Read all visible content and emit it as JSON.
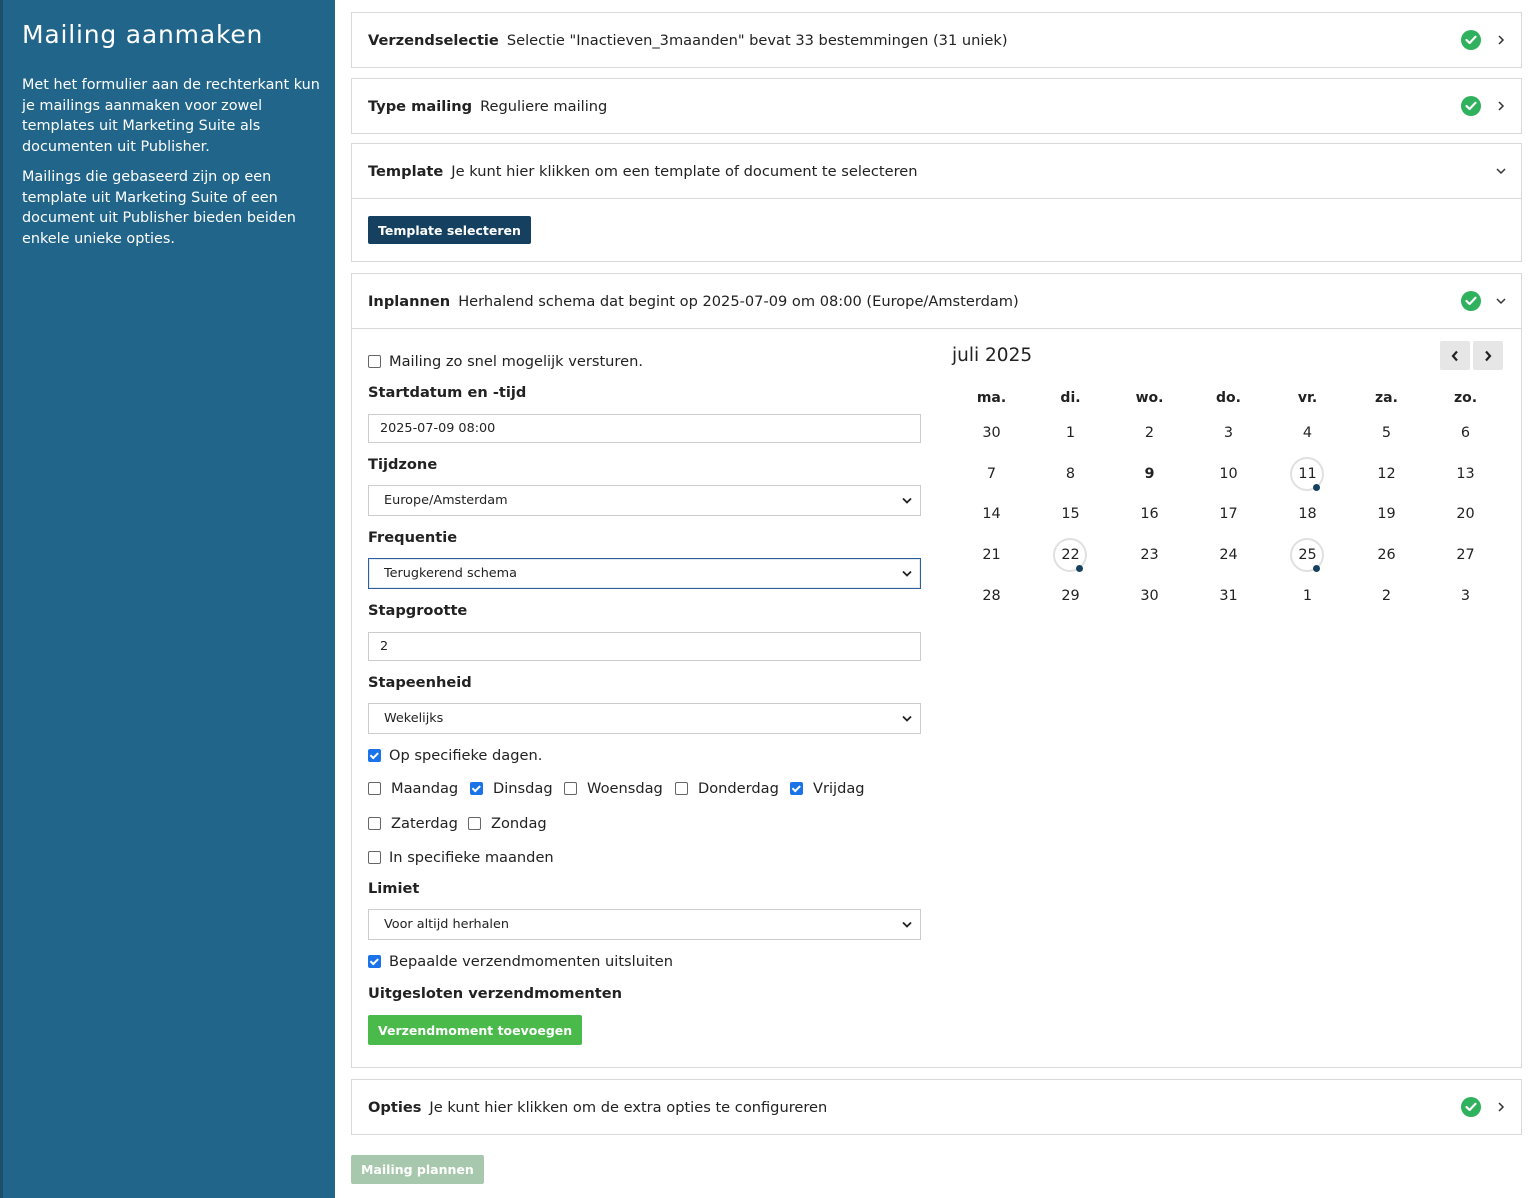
{
  "sidebar": {
    "title": "Mailing aanmaken",
    "paragraph1": "Met het formulier aan de rechterkant kun je mailings aanmaken voor zowel templates uit Marketing Suite als documenten uit Publisher.",
    "paragraph2": "Mailings die gebaseerd zijn op een template uit Marketing Suite of een document uit Publisher bieden beiden enkele unieke opties."
  },
  "panels": {
    "verzendselectie": {
      "title": "Verzendselectie",
      "summary": "Selectie \"Inactieven_3maanden\" bevat 33 bestemmingen (31 uniek)"
    },
    "type": {
      "title": "Type mailing",
      "summary": "Reguliere mailing"
    },
    "template": {
      "title": "Template",
      "summary": "Je kunt hier klikken om een template of document te selecteren",
      "button": "Template selecteren"
    },
    "inplannen": {
      "title": "Inplannen",
      "summary": "Herhalend schema dat begint op 2025-07-09 om 08:00 (Europe/Amsterdam)"
    },
    "opties": {
      "title": "Opties",
      "summary": "Je kunt hier klikken om de extra opties te configureren"
    }
  },
  "form": {
    "asap_label": "Mailing zo snel mogelijk versturen.",
    "start_label": "Startdatum en -tijd",
    "start_value": "2025-07-09 08:00",
    "timezone_label": "Tijdzone",
    "timezone_value": "Europe/Amsterdam",
    "frequency_label": "Frequentie",
    "frequency_value": "Terugkerend schema",
    "step_label": "Stapgrootte",
    "step_value": "2",
    "unit_label": "Stapeenheid",
    "unit_value": "Wekelijks",
    "specific_days_label": "Op specifieke dagen.",
    "days": [
      "Maandag",
      "Dinsdag",
      "Woensdag",
      "Donderdag",
      "Vrijdag",
      "Zaterdag",
      "Zondag"
    ],
    "specific_months_label": "In specifieke maanden",
    "limit_label": "Limiet",
    "limit_value": "Voor altijd herhalen",
    "exclude_label": "Bepaalde verzendmomenten uitsluiten",
    "excluded_title": "Uitgesloten verzendmomenten",
    "add_button": "Verzendmoment toevoegen"
  },
  "calendar": {
    "title": "juli 2025",
    "weekdays": [
      "ma.",
      "di.",
      "wo.",
      "do.",
      "vr.",
      "za.",
      "zo."
    ],
    "weeks": [
      [
        "30",
        "1",
        "2",
        "3",
        "4",
        "5",
        "6"
      ],
      [
        "7",
        "8",
        "9",
        "10",
        "11",
        "12",
        "13"
      ],
      [
        "14",
        "15",
        "16",
        "17",
        "18",
        "19",
        "20"
      ],
      [
        "21",
        "22",
        "23",
        "24",
        "25",
        "26",
        "27"
      ],
      [
        "28",
        "29",
        "30",
        "31",
        "1",
        "2",
        "3"
      ]
    ],
    "today": "9",
    "scheduled": [
      "11",
      "22",
      "25"
    ]
  },
  "footer": {
    "submit_button": "Mailing plannen"
  },
  "colors": {
    "sidebar": "#21658a",
    "accent_dark": "#16405f",
    "success": "#2fb15d",
    "add_green": "#4aba4a"
  }
}
